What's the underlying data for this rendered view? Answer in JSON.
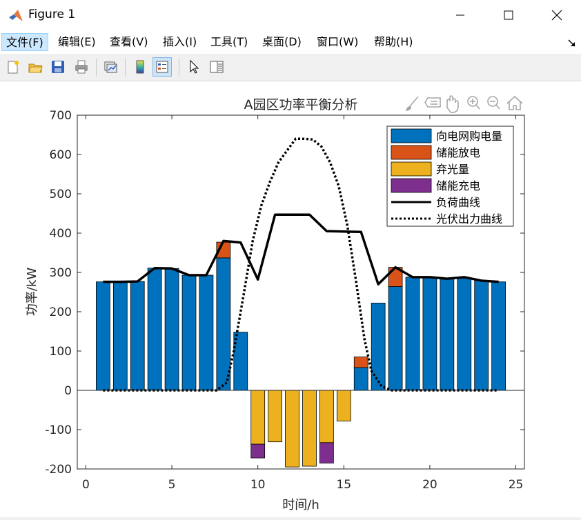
{
  "window": {
    "title": "Figure 1",
    "controls": {
      "minimize": "minimize-icon",
      "maximize": "maximize-icon",
      "close": "close-icon"
    }
  },
  "menu": {
    "items": [
      {
        "label": "文件(F)"
      },
      {
        "label": "编辑(E)"
      },
      {
        "label": "查看(V)"
      },
      {
        "label": "插入(I)"
      },
      {
        "label": "工具(T)"
      },
      {
        "label": "桌面(D)"
      },
      {
        "label": "窗口(W)"
      },
      {
        "label": "帮助(H)"
      }
    ],
    "dock_icon": "dock-arrow-icon"
  },
  "toolbar": {
    "buttons": [
      "new-figure-icon",
      "open-file-icon",
      "save-icon",
      "print-icon",
      "link-plot-icon",
      "insert-colorbar-icon",
      "insert-legend-icon",
      "edit-plot-icon",
      "property-inspector-icon"
    ]
  },
  "axes_toolbar": [
    "brush-icon",
    "data-tips-icon",
    "pan-icon",
    "zoom-in-icon",
    "zoom-out-icon",
    "home-icon"
  ],
  "colors": {
    "grid_purchase": "#0072BD",
    "storage_discharge": "#D95319",
    "pv_curtail": "#EDB120",
    "storage_charge": "#7E2F8E",
    "load": "#000000",
    "pv": "#000000"
  },
  "chart_data": {
    "type": "bar",
    "title": "A园区功率平衡分析",
    "xlabel": "时间/h",
    "ylabel": "功率/kW",
    "xlim": [
      -0.5,
      25.5
    ],
    "ylim": [
      -200,
      700
    ],
    "xticks": [
      0,
      5,
      10,
      15,
      20,
      25
    ],
    "yticks": [
      -200,
      -100,
      0,
      100,
      200,
      300,
      400,
      500,
      600,
      700
    ],
    "grid": false,
    "legend_position": "top-right",
    "x": [
      1,
      2,
      3,
      4,
      5,
      6,
      7,
      8,
      9,
      10,
      11,
      12,
      13,
      14,
      15,
      16,
      17,
      18,
      19,
      20,
      21,
      22,
      23,
      24
    ],
    "series": [
      {
        "name": "向电网购电量",
        "kind": "bar",
        "values": [
          276,
          276,
          277,
          311,
          310,
          293,
          293,
          337,
          148,
          0,
          0,
          0,
          0,
          0,
          0,
          58,
          222,
          264,
          288,
          288,
          284,
          285,
          280,
          276
        ]
      },
      {
        "name": "储能放电",
        "kind": "bar",
        "values": [
          0,
          0,
          0,
          0,
          0,
          0,
          0,
          40,
          0,
          0,
          0,
          0,
          0,
          0,
          0,
          27,
          0,
          49,
          0,
          0,
          0,
          0,
          0,
          0
        ]
      },
      {
        "name": "弃光量",
        "kind": "bar",
        "values": [
          0,
          0,
          0,
          0,
          0,
          0,
          0,
          0,
          0,
          -137,
          -131,
          -195,
          -193,
          -133,
          -78,
          0,
          0,
          0,
          0,
          0,
          0,
          0,
          0,
          0
        ]
      },
      {
        "name": "储能充电",
        "kind": "bar",
        "values": [
          0,
          0,
          0,
          0,
          0,
          0,
          0,
          0,
          0,
          -35,
          0,
          0,
          0,
          -52,
          0,
          0,
          0,
          0,
          0,
          0,
          0,
          0,
          0,
          0
        ]
      },
      {
        "name": "负荷曲线",
        "kind": "line",
        "values": [
          276,
          276,
          277,
          311,
          310,
          293,
          293,
          380,
          376,
          282,
          447,
          447,
          447,
          405,
          404,
          403,
          270,
          313,
          288,
          288,
          284,
          288,
          279,
          276
        ]
      },
      {
        "name": "光伏出力曲线",
        "kind": "dotted-line",
        "values": [
          0,
          0,
          0,
          0,
          0,
          0,
          0,
          0,
          0,
          0,
          0,
          0,
          0,
          0,
          0,
          0,
          0,
          0,
          0,
          0,
          0,
          0,
          0,
          0
        ],
        "x_fine": [
          1,
          7.6,
          8.2,
          8.6,
          9.2,
          9.7,
          10.2,
          10.7,
          11.2,
          11.7,
          12.2,
          12.7,
          13.2,
          13.7,
          14.2,
          14.7,
          15.2,
          15.7,
          16.2,
          16.6,
          17.2,
          17.8,
          24
        ],
        "y_fine": [
          0,
          0,
          20,
          100,
          250,
          380,
          470,
          530,
          580,
          610,
          640,
          640,
          638,
          620,
          580,
          520,
          420,
          280,
          130,
          50,
          10,
          0,
          0
        ]
      }
    ]
  }
}
